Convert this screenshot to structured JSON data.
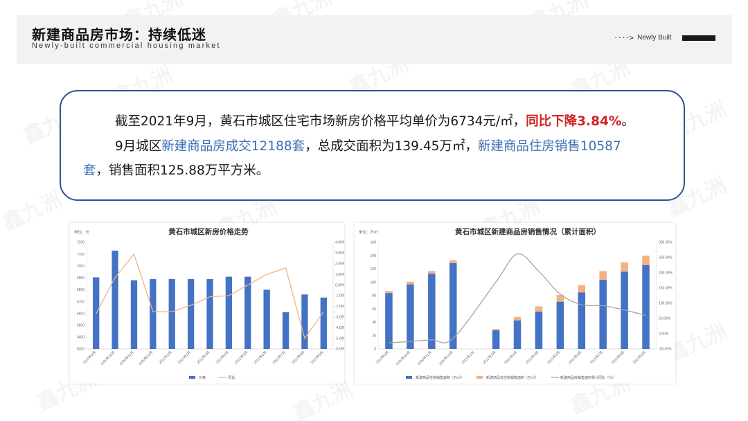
{
  "header": {
    "title": "新建商品房市场：持续低迷",
    "subtitle": "Newly-built commercial housing market",
    "badge_arrow": "····>",
    "badge_label": "Newly Built"
  },
  "watermark": "鑫九洲",
  "summary": {
    "line1_a": "截至2021年9月，黄石市城区住宅市场新房价格平均单价为6734元/㎡，",
    "line1_red": "同比下降3.84%",
    "line1_end": "。",
    "line2_a": "9月城区",
    "line2_blue1": "新建商品房成交12188套",
    "line2_b": "，总成交面积为139.45万㎡，",
    "line2_blue2": "新建商品住房销售10587",
    "line3_blue": "套",
    "line3_b": "，销售面积125.88万平方米。"
  },
  "colors": {
    "accent": "#2d5293",
    "bar_blue": "#4472c4",
    "bar_orange": "#f4b183",
    "line_orange": "#f4b183",
    "line_gray": "#a5a5a5",
    "highlight_red": "#d42323",
    "link_blue": "#3c6fb4"
  },
  "chart_data": [
    {
      "type": "bar",
      "title": "黄石市城区新房价格走势",
      "ylabel": "单位：元",
      "categories": [
        "2020年9月",
        "2020年10月",
        "2020年11月",
        "2020年12月",
        "2021年1月",
        "2021年2月",
        "2021年3月",
        "2021年4月",
        "2021年5月",
        "2021年6月",
        "2021年7月",
        "2021年8月",
        "2021年9月"
      ],
      "ylim": [
        6300,
        7200
      ],
      "yticks": [
        "6300",
        "6400",
        "6500",
        "6600",
        "6700",
        "6800",
        "6900",
        "7000",
        "7100",
        "7200"
      ],
      "y2lim": [
        -6,
        4
      ],
      "y2ticks": [
        "-6.00%",
        "-5.00%",
        "-4.00%",
        "-3.00%",
        "-2.00%",
        "-1.00%",
        "0.00%",
        "1.00%",
        "2.00%",
        "3.00%",
        "4.00%"
      ],
      "series": [
        {
          "name": "价格",
          "kind": "bar",
          "axis": "left",
          "values": [
            6905,
            7130,
            6880,
            6890,
            6890,
            6890,
            6890,
            6910,
            6910,
            6800,
            6610,
            6760,
            6734
          ]
        },
        {
          "name": "同比",
          "kind": "line",
          "axis": "right",
          "values": [
            -2.7,
            0.7,
            2.9,
            -2.5,
            -2.5,
            -1.9,
            -1.1,
            -1.0,
            0.0,
            1.0,
            1.6,
            -5.0,
            -2.5
          ]
        }
      ],
      "legend": "bottom"
    },
    {
      "type": "bar",
      "title": "黄石市城区新建商品房销售情况（累计面积）",
      "ylabel": "单位：万㎡",
      "categories": [
        "2020年9月",
        "2020年10月",
        "2020年11月",
        "2020年12月",
        "2021年1月",
        "2021年2月",
        "2021年3月",
        "2021年4月",
        "2021年5月",
        "2021年6月",
        "2021年7月",
        "2021年8月",
        "2021年9月"
      ],
      "ylim": [
        0,
        160
      ],
      "yticks": [
        "0",
        "20",
        "40",
        "60",
        "80",
        "100",
        "120",
        "140",
        "160"
      ],
      "y2lim": [
        -50,
        300
      ],
      "y2ticks": [
        "-50.00%",
        "0.00%",
        "50.00%",
        "100.00%",
        "150.00%",
        "200.00%",
        "250.00%",
        "300.00%"
      ],
      "series": [
        {
          "name": "新建商品住房销售面积（万㎡）",
          "kind": "bar",
          "axis": "left",
          "values": [
            84,
            97,
            113,
            129,
            null,
            28,
            43,
            56,
            71,
            85,
            104,
            116,
            126
          ]
        },
        {
          "name": "新建商品非住房销售面积（万㎡）",
          "kind": "bar",
          "axis": "left",
          "values": [
            3,
            4,
            4,
            4,
            null,
            2,
            5,
            8,
            10,
            11,
            13,
            14,
            14
          ]
        },
        {
          "name": "新建商品房销售面积累计同比（%）",
          "kind": "line",
          "axis": "right",
          "values": [
            -30,
            -25,
            -20,
            -15,
            null,
            170,
            262,
            205,
            130,
            95,
            92,
            78,
            60
          ]
        }
      ],
      "legend": "bottom"
    }
  ]
}
